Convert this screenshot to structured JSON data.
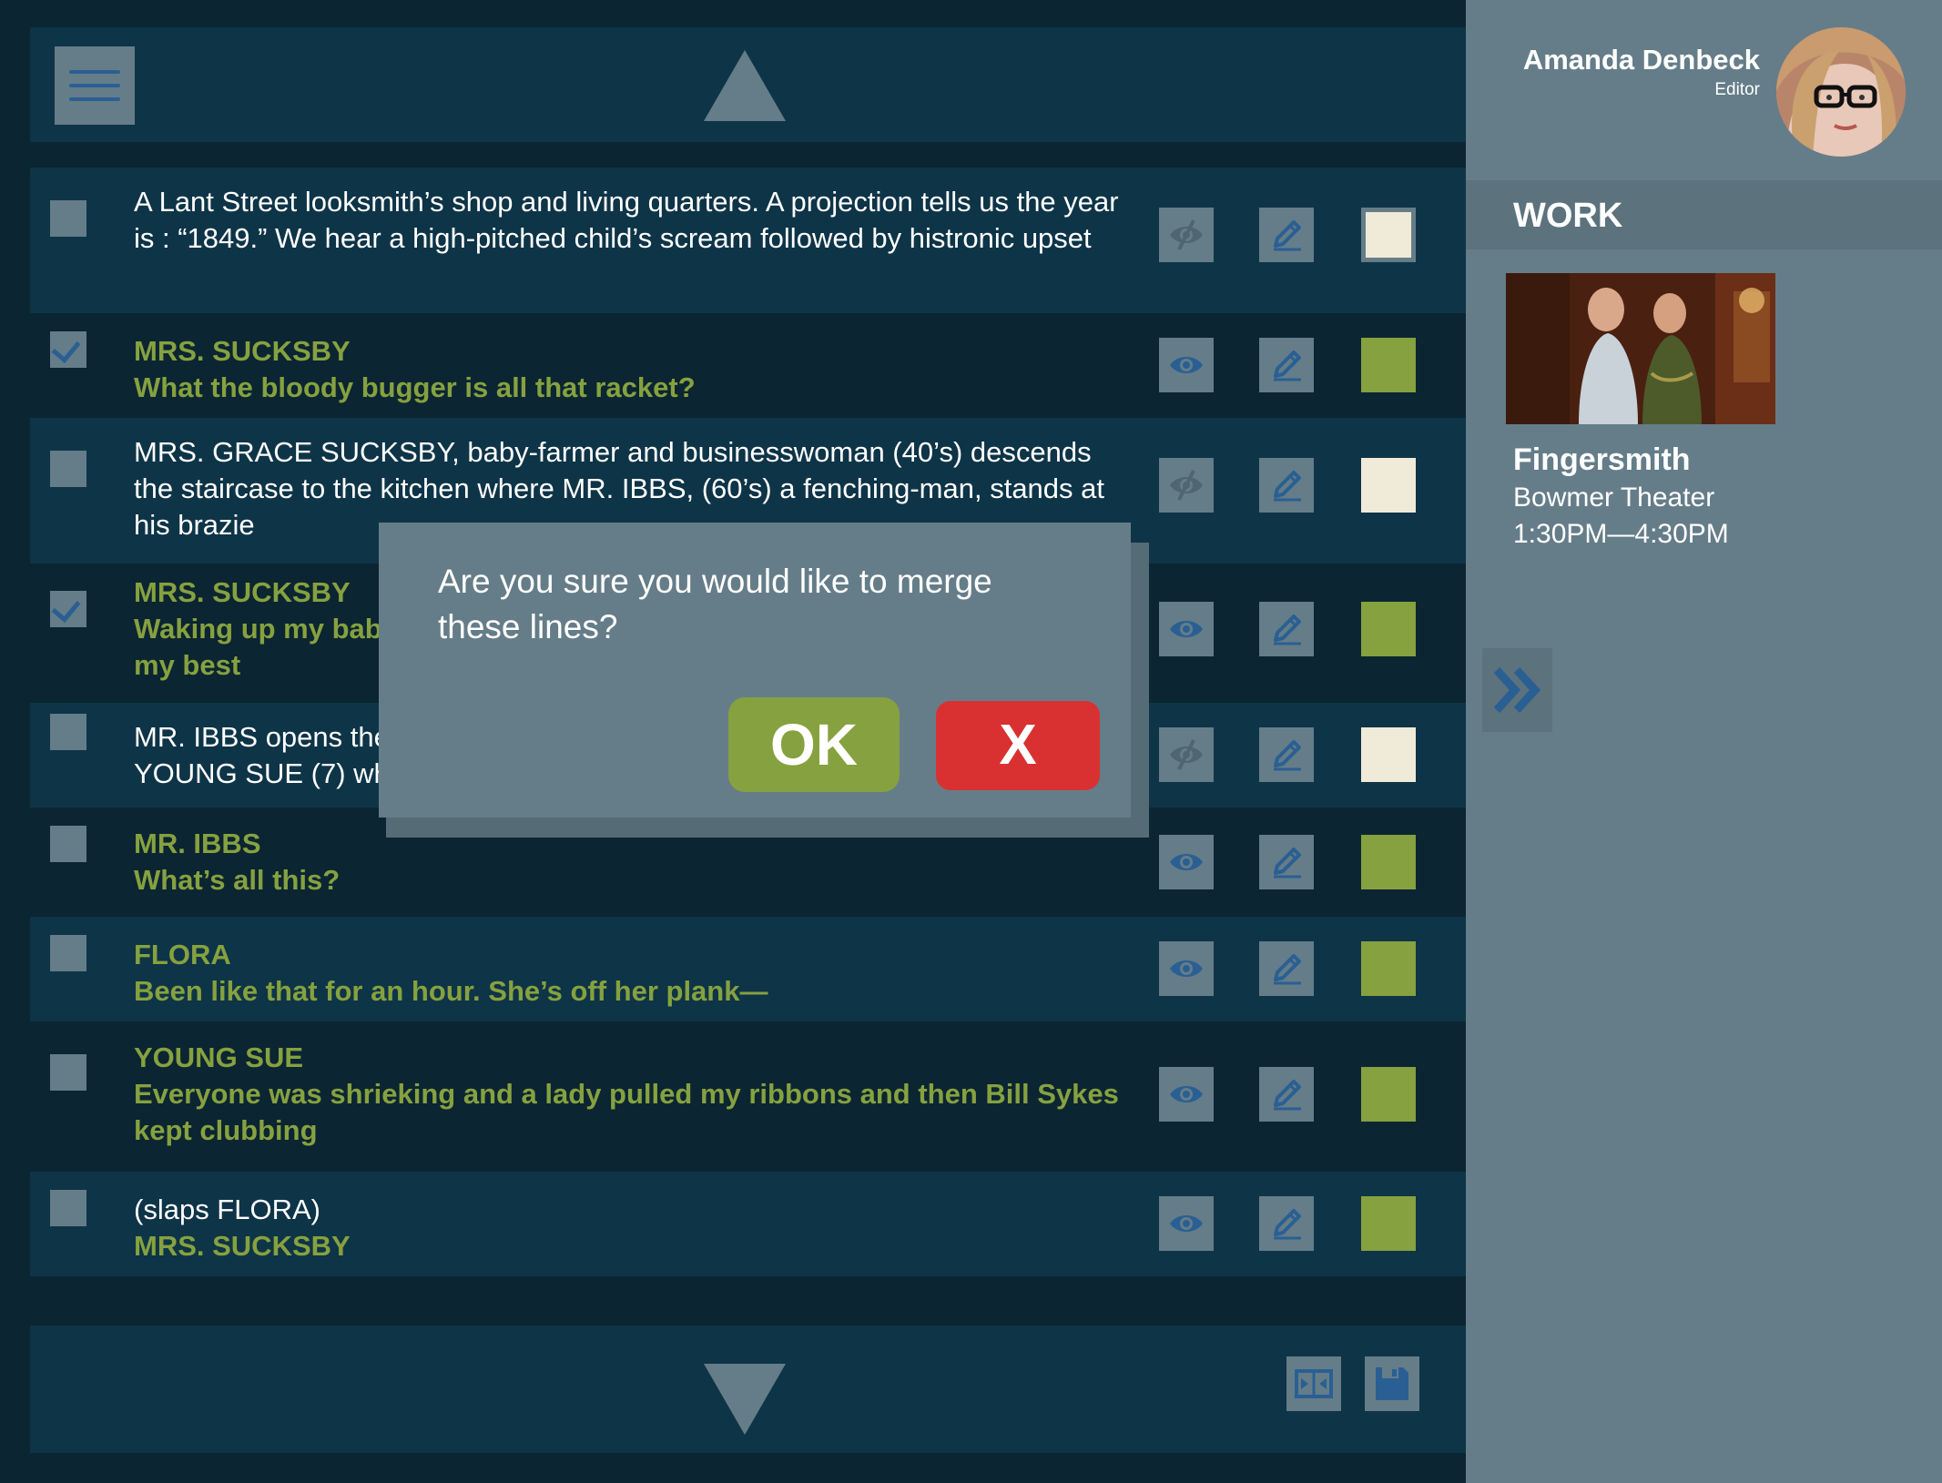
{
  "colors": {
    "background": "#0b2532",
    "row_alt": "#0e3447",
    "control_grey": "#657d88",
    "icon_blue": "#2a5f93",
    "dialogue_green": "#86a13f",
    "cream": "#f0ead9",
    "cancel_red": "#d93131"
  },
  "toolbar": {
    "menu_icon": "hamburger-icon",
    "scroll_up_icon": "triangle-up-icon",
    "scroll_down_icon": "triangle-down-icon",
    "merge_icon": "merge-icon",
    "save_icon": "floppy-disk-icon"
  },
  "lines": [
    {
      "type": "description",
      "checked": false,
      "visible": false,
      "color": "cream",
      "text": "A Lant Street looksmith’s shop and living quarters. A projection tells us the year is : “1849.” We hear a high-pitched child’s scream followed by histronic upset"
    },
    {
      "type": "dialogue",
      "checked": true,
      "visible": true,
      "color": "green",
      "text": "MRS. SUCKSBY\nWhat the bloody bugger is all that racket?"
    },
    {
      "type": "description",
      "checked": false,
      "visible": false,
      "color": "cream",
      "text": "MRS. GRACE SUCKSBY, baby-farmer and businesswoman (40’s) descends the staircase to the kitchen where MR. IBBS, (60’s) a fenching-man, stands at his brazie"
    },
    {
      "type": "dialogue",
      "checked": true,
      "visible": true,
      "color": "green",
      "text": "MRS. SUCKSBY\nWaking up my babi\nmy best"
    },
    {
      "type": "description",
      "checked": false,
      "visible": false,
      "color": "cream",
      "text": "MR. IBBS opens the\nYOUNG SUE (7) who"
    },
    {
      "type": "dialogue",
      "checked": false,
      "visible": true,
      "color": "green",
      "text": "MR. IBBS\nWhat’s all this?"
    },
    {
      "type": "dialogue",
      "checked": false,
      "visible": true,
      "color": "green",
      "text": "FLORA\nBeen like that for an hour. She’s off her plank—"
    },
    {
      "type": "dialogue",
      "checked": false,
      "visible": true,
      "color": "green",
      "text": "YOUNG SUE\nEveryone was shrieking and a lady pulled my ribbons and then Bill Sykes kept clubbing"
    },
    {
      "type": "mixed",
      "checked": false,
      "visible": true,
      "color": "green",
      "text": "(slaps FLORA)",
      "text2": "MRS. SUCKSBY"
    }
  ],
  "user": {
    "name": "Amanda Denbeck",
    "role": "Editor"
  },
  "sidebar": {
    "section_label": "WORK",
    "work_title": "Fingersmith",
    "work_venue": "Bowmer Theater",
    "work_time": "1:30PM—4:30PM",
    "expand_icon": "double-chevron-right-icon"
  },
  "dialog": {
    "message": "Are you sure you would like to merge these lines?",
    "ok_label": "OK",
    "cancel_label": "X"
  }
}
